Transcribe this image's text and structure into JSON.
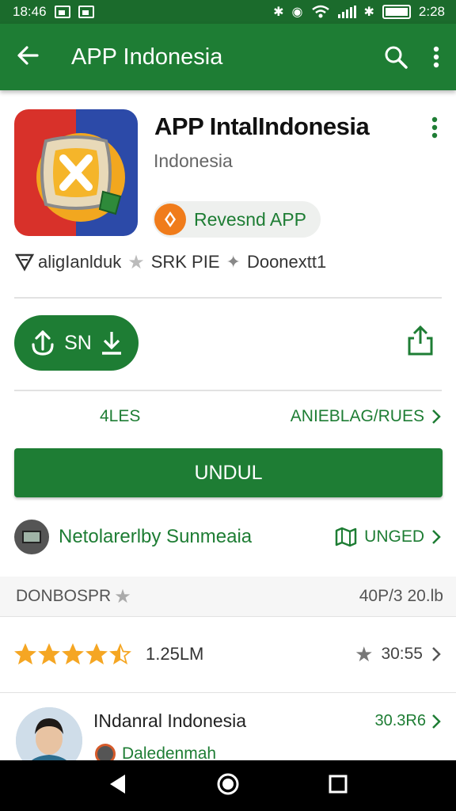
{
  "status_bar": {
    "time_left": "18:46",
    "time_right": "2:28"
  },
  "app_bar": {
    "title": "APP Indonesia",
    "back_icon": "arrow-left-icon",
    "search_icon": "search-icon",
    "menu_icon": "more-vert-icon"
  },
  "app": {
    "title": "APP IntalIndonesia",
    "developer": "Indonesia",
    "badge_label": "Revesnd APP"
  },
  "tags": [
    "aligIanlduk",
    "SRK PIE",
    "Doonextt1"
  ],
  "install_button": {
    "label": "SN"
  },
  "info_row": {
    "left": "4LES",
    "right": "ANIEBLAG/RUES"
  },
  "download_button": {
    "label": "UNDUL"
  },
  "developer_row": {
    "name": "Netolarerlby Sunmeaia",
    "action": "UNGED"
  },
  "section_header": {
    "left": "DONBOSPR",
    "right": "40P/3 20.lb"
  },
  "rating_row": {
    "stars": 4.5,
    "count": "1.25LM",
    "right": "30:55"
  },
  "review": {
    "name": "INdanral Indonesia",
    "tag": "30.3R6",
    "sub": "Daledenmah"
  },
  "colors": {
    "primary": "#1e7d34",
    "status_bar": "#1b6b2c",
    "accent_orange": "#f07c1b",
    "star": "#f5a623"
  }
}
